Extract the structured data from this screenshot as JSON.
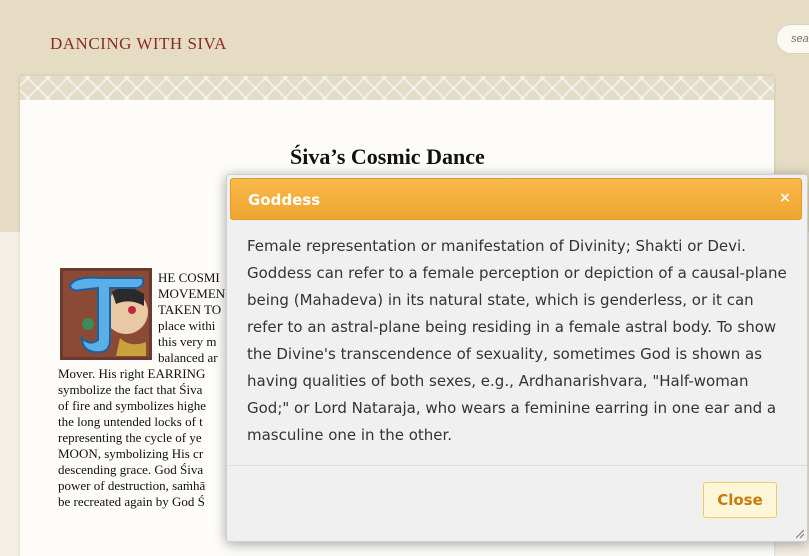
{
  "site": {
    "title": "DANCING WITH SIVA",
    "search_placeholder": "search"
  },
  "article": {
    "title": "Śiva’s Cosmic Dance",
    "dropcap_letter": "T",
    "lines": [
      "HE COSMI",
      "MOVEMEN",
      "TAKEN TO",
      "place withi",
      "this very m",
      "balanced ar",
      "Mover. His right EARRING",
      "symbolize the fact that Śiva",
      "of fire and symbolizes highe",
      "the long untended locks of t",
      "representing the cycle of ye",
      "MOON, symbolizing His cr",
      "descending grace. God Śiva",
      "power of destruction, saṁhā",
      "be recreated again by God Ś"
    ]
  },
  "dialog": {
    "title": "Goddess",
    "close_glyph": "×",
    "content": "Female representation or manifestation of Divinity; Shakti or Devi. Goddess can refer to a female perception or depiction of a causal-plane being (Mahadeva) in its natural state, which is genderless, or it can refer to an astral-plane being residing in a female astral body. To show the Divine's transcendence of sexuality, sometimes God is shown as having qualities of both sexes, e.g., Ardhanarishvara, \"Half-woman God;\" or Lord Nataraja, who wears a feminine earring in one ear and a masculine one in the other.",
    "close_button_label": "Close"
  },
  "colors": {
    "brand": "#8b2a2a",
    "dialog_header": "#f0a530",
    "close_button_text": "#c77b12"
  },
  "icons": {
    "dialog_close": "close-icon",
    "resize": "resize-handle-icon",
    "dropcap": "illuminated-letter-t-icon"
  }
}
